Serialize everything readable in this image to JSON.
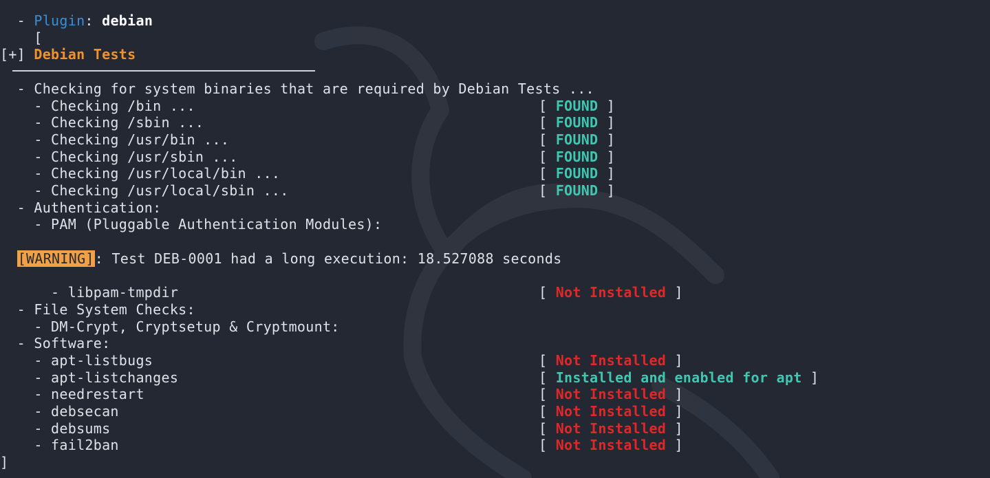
{
  "terminal": {
    "plugin_label": "Plugin",
    "plugin_name": "debian",
    "open_bracket": "[",
    "section_marker": "[+]",
    "section_title": "Debian Tests",
    "binaries_header": "Checking for system binaries that are required by Debian Tests ...",
    "binaries": [
      {
        "label": "Checking /bin ...",
        "status": "FOUND"
      },
      {
        "label": "Checking /sbin ...",
        "status": "FOUND"
      },
      {
        "label": "Checking /usr/bin ...",
        "status": "FOUND"
      },
      {
        "label": "Checking /usr/sbin ...",
        "status": "FOUND"
      },
      {
        "label": "Checking /usr/local/bin ...",
        "status": "FOUND"
      },
      {
        "label": "Checking /usr/local/sbin ...",
        "status": "FOUND"
      }
    ],
    "auth_header": "Authentication:",
    "pam_header": "PAM (Pluggable Authentication Modules):",
    "warning_tag": "[WARNING]",
    "warning_text": ": Test DEB-0001 had a long execution: 18.527088 seconds",
    "libpam": {
      "label": "libpam-tmpdir",
      "status": "Not Installed"
    },
    "fs_header": "File System Checks:",
    "dm_crypt": "DM-Crypt, Cryptsetup & Cryptmount:",
    "software_header": "Software:",
    "software": [
      {
        "label": "apt-listbugs",
        "status": "Not Installed"
      },
      {
        "label": "apt-listchanges",
        "status": "Installed and enabled for apt"
      },
      {
        "label": "needrestart",
        "status": "Not Installed"
      },
      {
        "label": "debsecan",
        "status": "Not Installed"
      },
      {
        "label": "debsums",
        "status": "Not Installed"
      },
      {
        "label": "fail2ban",
        "status": "Not Installed"
      }
    ],
    "close_bracket": "]"
  },
  "colors": {
    "background": "#232833",
    "found": "#41c7b0",
    "not_installed": "#e12727",
    "title": "#f0922e",
    "warning_bg": "#f0a046",
    "plugin_label": "#3a8fd8"
  }
}
